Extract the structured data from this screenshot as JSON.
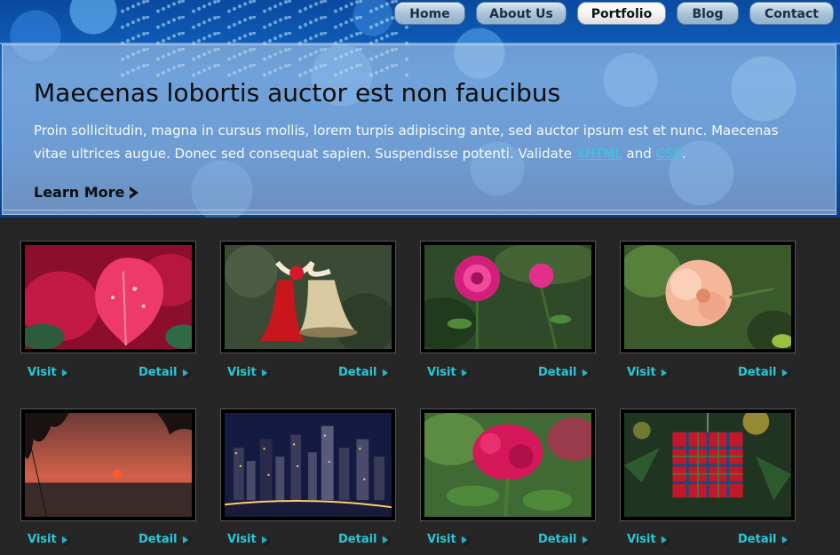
{
  "nav": {
    "items": [
      {
        "label": "Home",
        "active": false
      },
      {
        "label": "About Us",
        "active": false
      },
      {
        "label": "Portfolio",
        "active": true
      },
      {
        "label": "Blog",
        "active": false
      },
      {
        "label": "Contact",
        "active": false
      }
    ]
  },
  "hero": {
    "title": "Maecenas lobortis auctor est non faucibus",
    "text_before": "Proin sollicitudin, magna in cursus mollis, lorem turpis adipiscing ante, sed auctor ipsum est et nunc. Maecenas vitae ultrices augue. Donec sed consequat sapien. Suspendisse potenti. Validate ",
    "link_xhtml": "XHTML",
    "text_and": " and ",
    "link_css": "CSS",
    "text_end": ".",
    "learn_more": "Learn More",
    "learn_more_icon": "chevron-right-icon"
  },
  "gallery": {
    "visit_label": "Visit",
    "detail_label": "Detail",
    "link_icon": "arrow-circle-icon",
    "items": [
      {
        "subject": "red poinsettia leaf with water drops"
      },
      {
        "subject": "christmas bells with ribbon"
      },
      {
        "subject": "pink roses"
      },
      {
        "subject": "peach carnation flower"
      },
      {
        "subject": "sunset over sea"
      },
      {
        "subject": "city skyline at night"
      },
      {
        "subject": "red celosia flower"
      },
      {
        "subject": "plaid gift box ornament"
      }
    ]
  },
  "colors": {
    "accent_link": "#25c9d8",
    "page_background": "#262626",
    "header_blue": "#1268c6"
  }
}
